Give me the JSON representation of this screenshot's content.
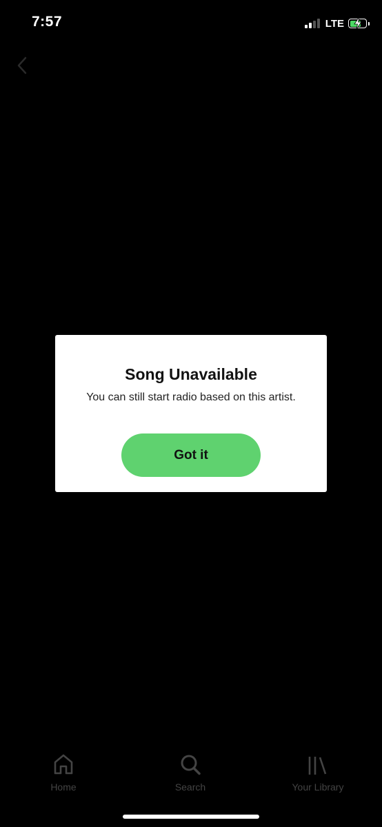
{
  "status_bar": {
    "time": "7:57",
    "network": "LTE",
    "battery_fill": 0.75,
    "charging": true
  },
  "dialog": {
    "title": "Song Unavailable",
    "message": "You can still start radio based on this artist.",
    "button_label": "Got it"
  },
  "nav": {
    "items": [
      {
        "label": "Home",
        "icon": "home-icon"
      },
      {
        "label": "Search",
        "icon": "search-icon"
      },
      {
        "label": "Your Library",
        "icon": "library-icon"
      }
    ]
  },
  "colors": {
    "background": "#000000",
    "accent": "#5fd26f",
    "battery": "#4cd964",
    "nav_inactive": "#444444"
  }
}
